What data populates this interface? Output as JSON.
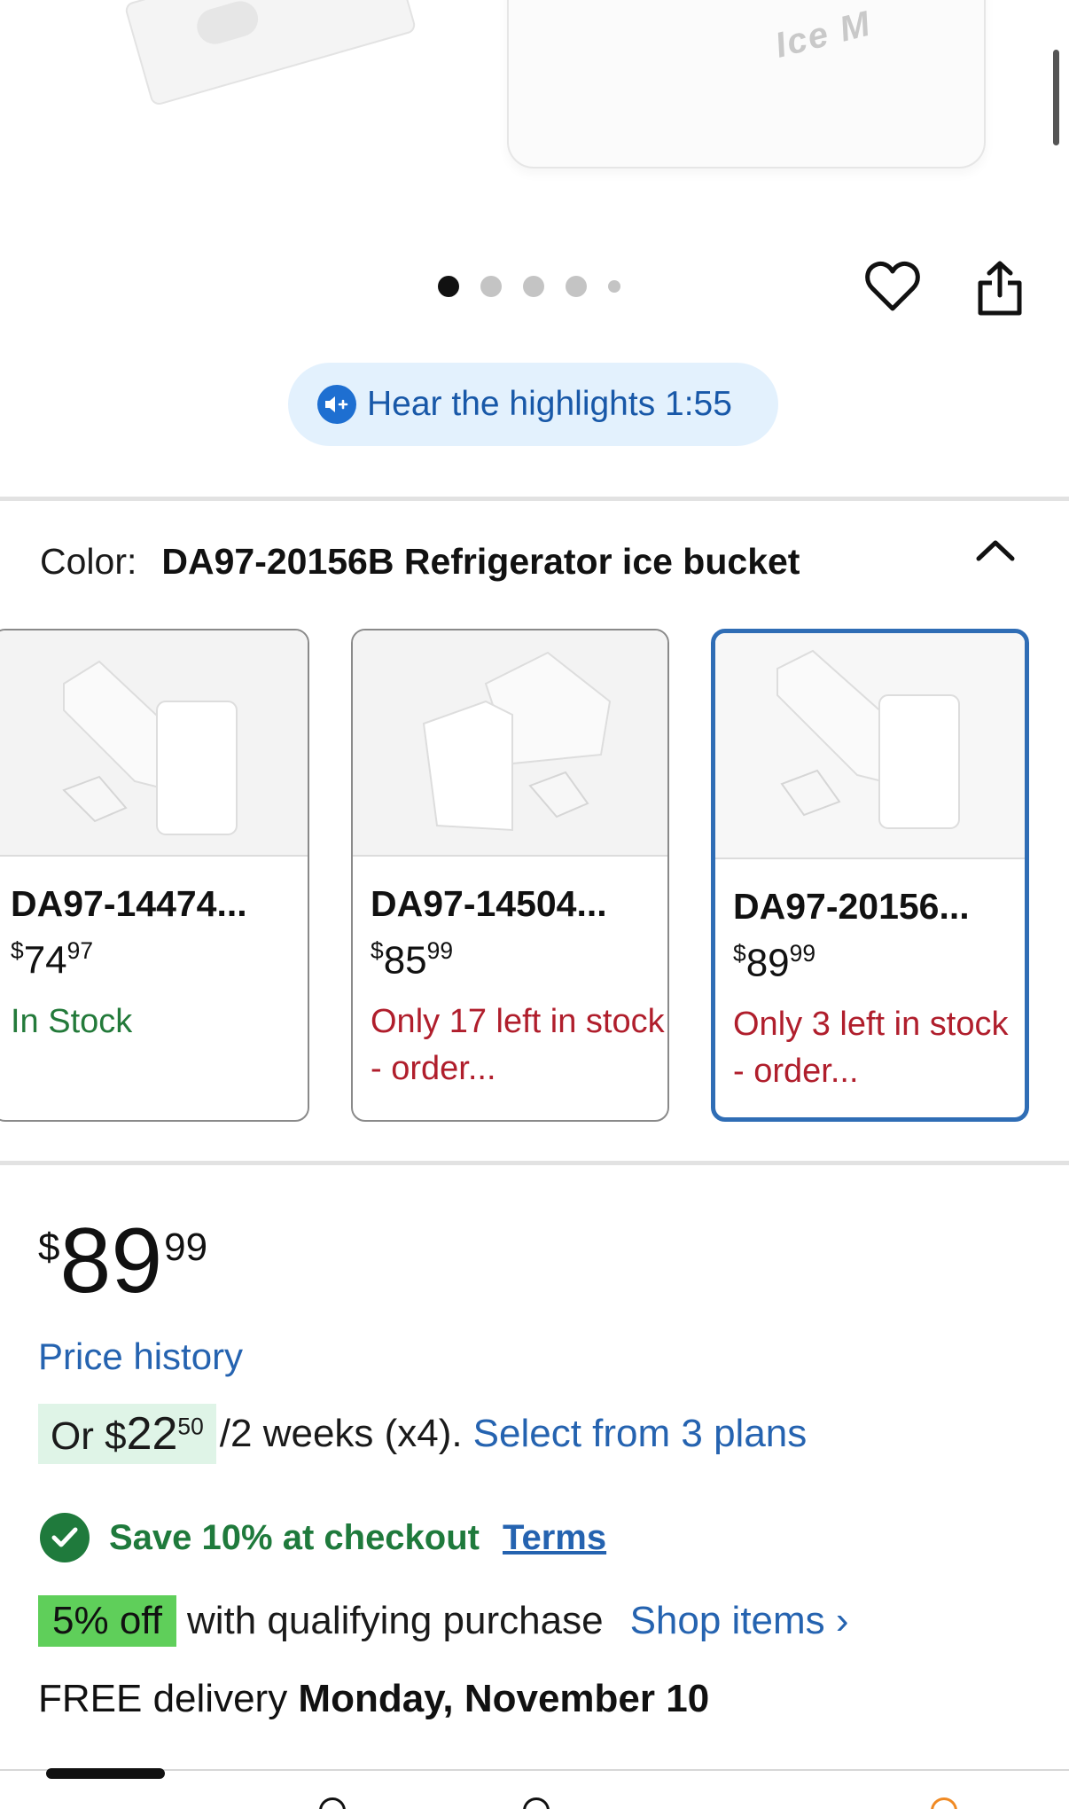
{
  "hero": {
    "box_text": "Ice M",
    "carousel": {
      "count": 5,
      "active_index": 0
    }
  },
  "icons": {
    "favorite": "heart-outline-icon",
    "share": "share-icon",
    "audio": "audio-highlights-icon",
    "collapse": "chevron-up-icon",
    "check": "check-circle-icon"
  },
  "highlights": {
    "label": "Hear the highlights 1:55"
  },
  "color": {
    "label": "Color:",
    "value": "DA97-20156B Refrigerator ice bucket"
  },
  "variants": [
    {
      "name": "DA97-14474...",
      "price_dollars": "74",
      "price_cents": "97",
      "currency": "$",
      "stock": "In Stock",
      "stock_status": "in",
      "selected": false
    },
    {
      "name": "DA97-14504...",
      "price_dollars": "85",
      "price_cents": "99",
      "currency": "$",
      "stock": "Only 17 left in stock - order...",
      "stock_status": "low",
      "selected": false
    },
    {
      "name": "DA97-20156...",
      "price_dollars": "89",
      "price_cents": "99",
      "currency": "$",
      "stock": "Only 3 left in stock - order...",
      "stock_status": "low",
      "selected": true
    }
  ],
  "price": {
    "currency": "$",
    "dollars": "89",
    "cents": "99"
  },
  "price_history": "Price history",
  "installment": {
    "prefix": "Or $",
    "amount_dollars": "22",
    "amount_cents": "50",
    "terms": "/2 weeks (x4).",
    "link": "Select from 3 plans"
  },
  "savings": {
    "text": "Save 10% at checkout",
    "terms": "Terms"
  },
  "offer": {
    "badge": "5% off",
    "text": "with qualifying purchase",
    "link": "Shop items ›"
  },
  "delivery": {
    "prefix": "FREE delivery",
    "date": "Monday, November 10"
  },
  "colors": {
    "link": "#2563b0",
    "in_stock": "#237a3a",
    "low_stock": "#b01e2c",
    "selected_border": "#2f6db5",
    "offer_badge": "#5fcf5a",
    "save_green": "#1f7a3c"
  }
}
